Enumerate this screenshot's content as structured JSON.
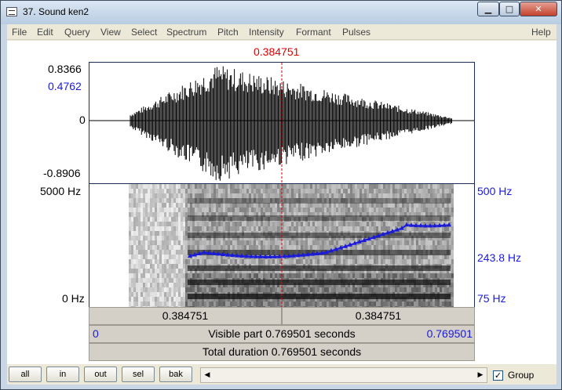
{
  "window": {
    "title": "37. Sound ken2",
    "minimize": "▁",
    "maximize": "□",
    "close": "✕"
  },
  "menu": [
    "File",
    "Edit",
    "Query",
    "View",
    "Select",
    "Spectrum",
    "Pitch",
    "Intensity",
    "Formant",
    "Pulses",
    "Help"
  ],
  "cursor": {
    "time": "0.384751"
  },
  "waveform": {
    "max": "0.8366",
    "value_at_cursor": "0.4762",
    "zero": "0",
    "min": "-0.8906"
  },
  "spectrogram": {
    "top": "5000 Hz",
    "bottom": "0 Hz"
  },
  "pitch": {
    "top": "500 Hz",
    "value_at_cursor": "243.8 Hz",
    "bottom": "75 Hz"
  },
  "time_bar": {
    "left": "0.384751",
    "right": "0.384751"
  },
  "visible_bar": {
    "start": "0",
    "label": "Visible part 0.769501 seconds",
    "end": "0.769501"
  },
  "total_bar": {
    "label": "Total duration 0.769501 seconds"
  },
  "toolbar": {
    "all": "all",
    "in": "in",
    "out": "out",
    "sel": "sel",
    "bak": "bak",
    "group_label": "Group",
    "group_checked": "✓"
  },
  "colors": {
    "cursor": "#e00000",
    "pitch": "#1a1adb"
  }
}
